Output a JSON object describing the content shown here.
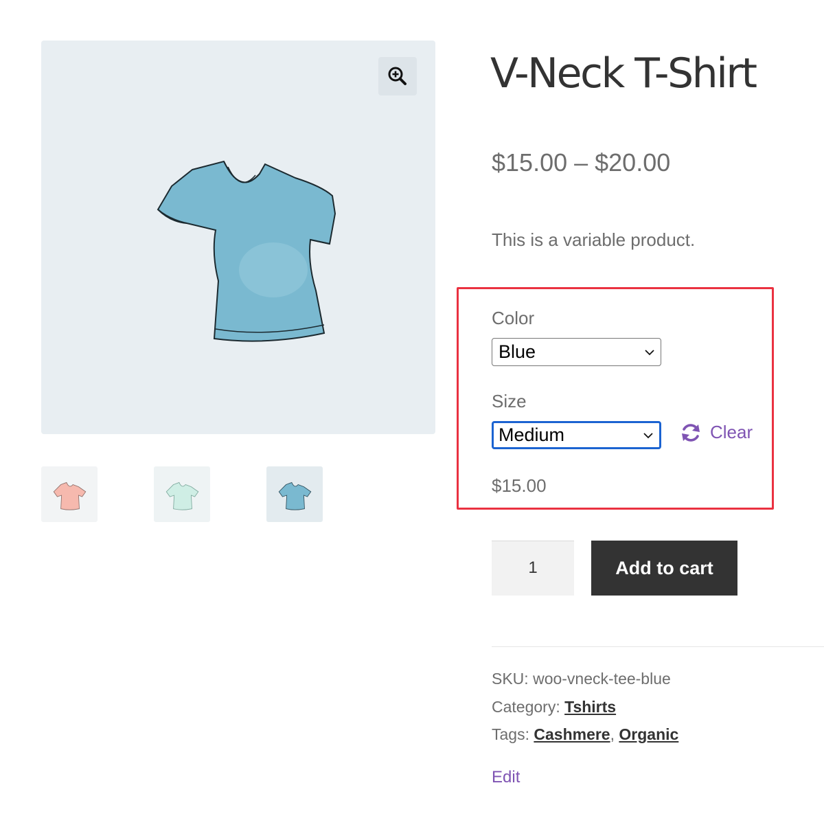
{
  "product": {
    "title": "V-Neck T-Shirt",
    "price_range": "$15.00 – $20.00",
    "description": "This is a variable product."
  },
  "gallery": {
    "zoom_icon": "zoom-in-icon",
    "thumbnails": [
      {
        "color": "pink",
        "fill": "#f6b9ae"
      },
      {
        "color": "green",
        "fill": "#cfeee5"
      },
      {
        "color": "blue",
        "fill": "#7ab9d0"
      }
    ]
  },
  "variations": {
    "color_label": "Color",
    "color_value": "Blue",
    "size_label": "Size",
    "size_value": "Medium",
    "clear_label": "Clear",
    "clear_icon": "refresh-icon",
    "variation_price": "$15.00"
  },
  "cart": {
    "quantity": "1",
    "add_to_cart_label": "Add to cart"
  },
  "meta": {
    "sku_label": "SKU:",
    "sku_value": "woo-vneck-tee-blue",
    "category_label": "Category:",
    "category_link": "Tshirts",
    "tags_label": "Tags:",
    "tags": [
      "Cashmere",
      "Organic"
    ],
    "tag_separator": ","
  },
  "admin": {
    "edit_label": "Edit"
  },
  "colors": {
    "accent": "#7f54b3",
    "highlight_border": "#ea3140",
    "button_bg": "#333333",
    "focus_ring": "#1b63d1"
  }
}
